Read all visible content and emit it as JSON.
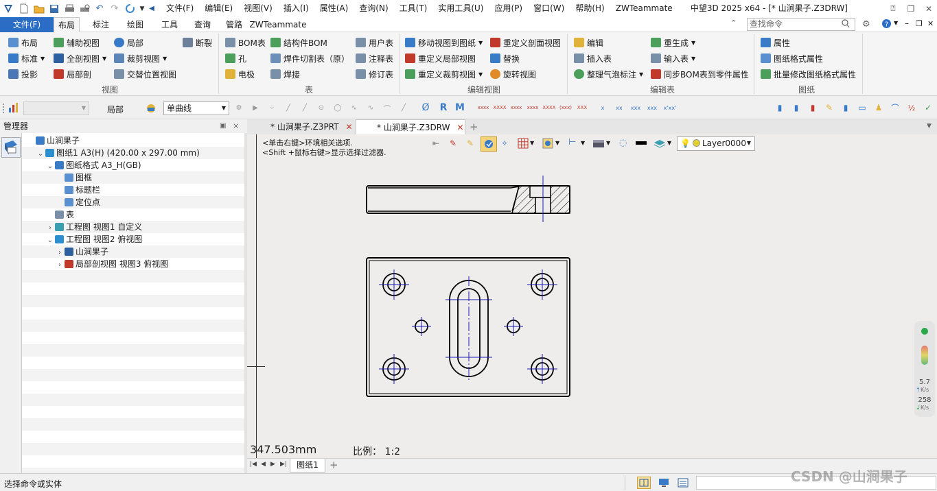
{
  "titlebar": {
    "menus": [
      "文件(F)",
      "编辑(E)",
      "视图(V)",
      "插入(I)",
      "属性(A)",
      "查询(N)",
      "工具(T)",
      "实用工具(U)",
      "应用(P)",
      "窗口(W)",
      "帮助(H)",
      "ZWTeammate"
    ],
    "window_title": "中望3D 2025 x64 - [* 山涧果子.Z3DRW]"
  },
  "ribbon_tabs": {
    "file": "文件(F)",
    "tabs": [
      "布局",
      "标注",
      "绘图",
      "工具",
      "查询",
      "管路",
      "ZWTeammate"
    ],
    "active": "布局",
    "search_placeholder": "查找命令"
  },
  "ribbon": {
    "view_group": {
      "label": "视图",
      "items": [
        "布局",
        "辅助视图",
        "局部",
        "断裂",
        "标准",
        "全剖视图",
        "裁剪视图",
        "投影",
        "局部剖",
        "交替位置视图"
      ]
    },
    "table_group": {
      "label": "表",
      "items": [
        "BOM表",
        "结构件BOM",
        "用户表",
        "孔",
        "焊件切割表（原）",
        "注释表",
        "电极",
        "焊接",
        "修订表"
      ]
    },
    "edit_view_group": {
      "label": "编辑视图",
      "items": [
        "移动视图到图纸",
        "重定义剖面视图",
        "重定义局部视图",
        "替换",
        "重定义裁剪视图",
        "旋转视图"
      ]
    },
    "edit_table_group": {
      "label": "编辑表",
      "items": [
        "编辑",
        "重生成",
        "插入表",
        "输入表",
        "整理气泡标注",
        "同步BOM表到零件属性"
      ]
    },
    "sheet_group": {
      "label": "图纸",
      "items": [
        "属性",
        "图纸格式属性",
        "批量修改图纸格式属性"
      ]
    }
  },
  "toolrow": {
    "local_label": "局部",
    "line_type": "单曲线",
    "layer": "Layer0000"
  },
  "manager": {
    "title": "管理器",
    "tree": [
      {
        "label": "山涧果子",
        "indent": 0
      },
      {
        "label": "图纸1 A3(H) (420.00 x 297.00 mm)",
        "indent": 1
      },
      {
        "label": "图纸格式 A3_H(GB)",
        "indent": 2
      },
      {
        "label": "图框",
        "indent": 3
      },
      {
        "label": "标题栏",
        "indent": 3
      },
      {
        "label": "定位点",
        "indent": 3
      },
      {
        "label": "表",
        "indent": 2
      },
      {
        "label": "工程图 视图1 自定义",
        "indent": 2
      },
      {
        "label": "工程图 视图2 俯视图",
        "indent": 2
      },
      {
        "label": "山涧果子",
        "indent": 3
      },
      {
        "label": "局部剖视图 视图3 俯视图",
        "indent": 3
      }
    ]
  },
  "doc_tabs": [
    "* 山涧果子.Z3PRT",
    "* 山涧果子.Z3DRW"
  ],
  "canvas": {
    "hint1": "<单击右键>环境相关选项.",
    "hint2": "<Shift +鼠标右键>显示选择过滤器.",
    "measure": "347.503mm",
    "scale": "比例：  1:2"
  },
  "sheet_tab": "图纸1",
  "net_widget": {
    "up": "5.7",
    "up_unit": "K/s",
    "down": "258",
    "down_unit": "K/s"
  },
  "status": {
    "prompt": "选择命令或实体",
    "watermark": "CSDN @山涧果子"
  }
}
